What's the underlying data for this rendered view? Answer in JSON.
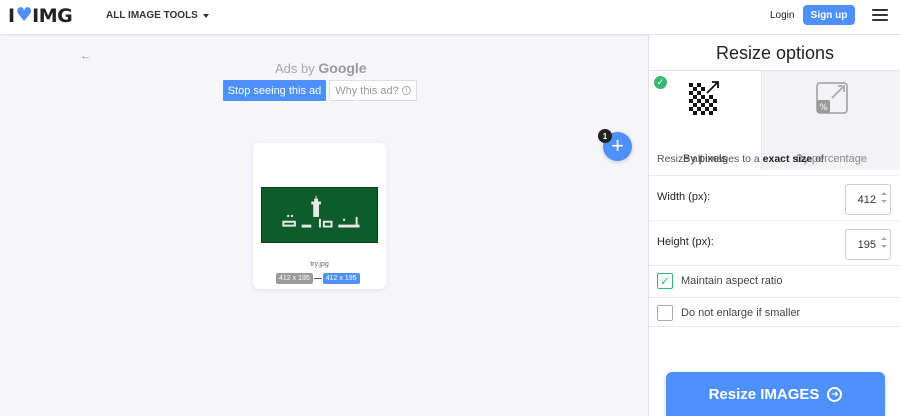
{
  "header": {
    "logo_left": "I",
    "logo_right": "IMG",
    "tools_menu": "ALL IMAGE TOOLS",
    "login": "Login",
    "signup": "Sign up"
  },
  "workspace": {
    "back_arrow": "←",
    "ads_by": "Ads by",
    "ads_brand": "Google",
    "stop_ad": "Stop seeing this ad",
    "why_ad": "Why this ad?",
    "file_count_badge": "1",
    "file": {
      "name": "try.jpg",
      "original_dims": "412 x 195",
      "new_dims": "412 x 195"
    }
  },
  "panel": {
    "title": "Resize options",
    "tab_pixels": "By pixels",
    "tab_percent": "By percentage",
    "desc_prefix": "Resize all images to a",
    "desc_bold": "exact size",
    "desc_suffix": "of",
    "width_label": "Width (px):",
    "width_value": "412",
    "height_label": "Height (px):",
    "height_value": "195",
    "maintain_aspect": "Maintain aspect ratio",
    "maintain_aspect_checked": true,
    "no_enlarge": "Do not enlarge if smaller",
    "no_enlarge_checked": false,
    "resize_button": "Resize IMAGES"
  },
  "colors": {
    "accent": "#4d90fe",
    "success": "#37b772"
  }
}
